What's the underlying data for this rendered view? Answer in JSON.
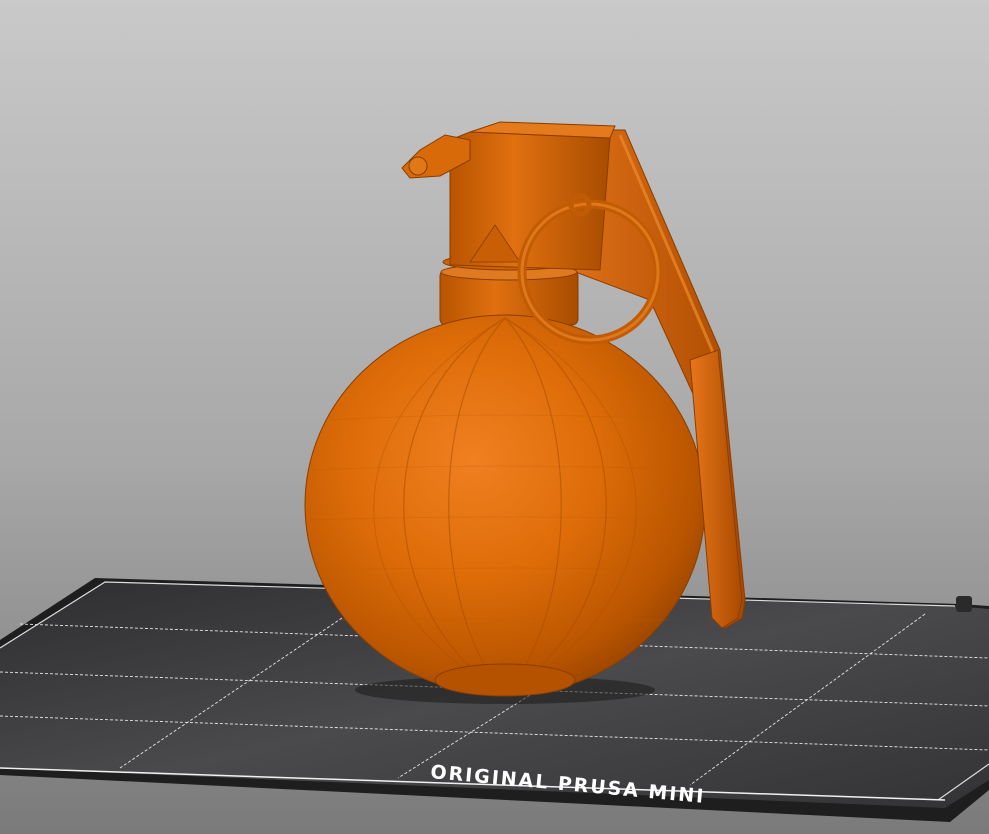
{
  "viewport": {
    "background_top": "#c8c8c8",
    "background_bottom": "#7c7c7c"
  },
  "print_bed": {
    "label": "ORIGINAL PRUSA MINI",
    "surface_color": "#3a3a3c",
    "grid_line_color": "#e6e6e6",
    "label_color": "#ffffff"
  },
  "model": {
    "icon": "grenade-model",
    "color": "#d96a00"
  }
}
